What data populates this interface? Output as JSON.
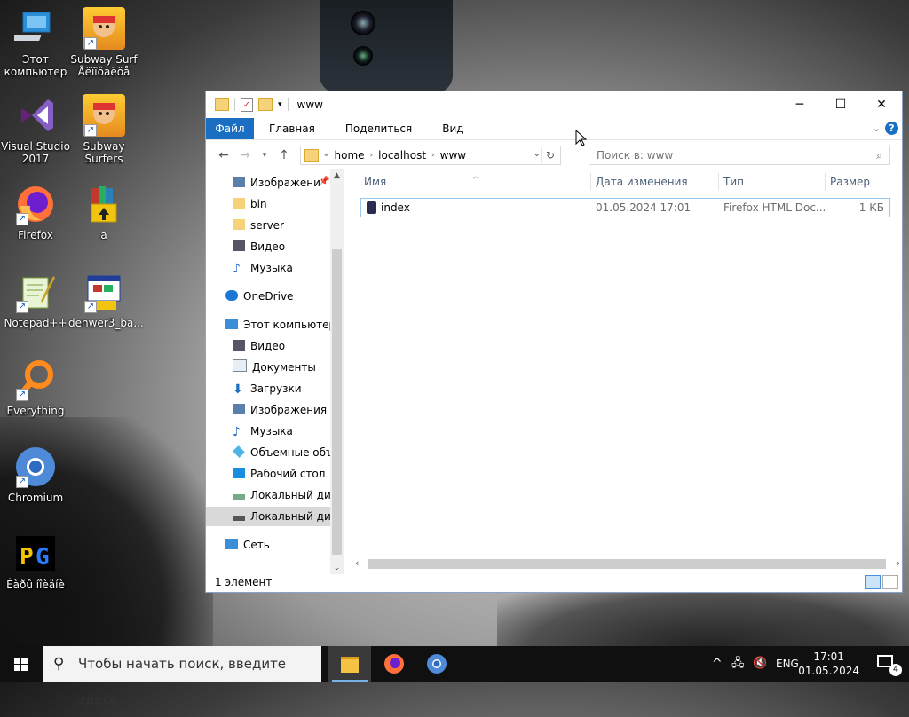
{
  "desktop": {
    "icons": [
      {
        "label": "Этот\nкомпьютер"
      },
      {
        "label": "Subway Surf\nÂëïîôàëöå"
      },
      {
        "label": "Visual Studio\n2017"
      },
      {
        "label": "Subway\nSurfers"
      },
      {
        "label": "Firefox"
      },
      {
        "label": "a"
      },
      {
        "label": "Notepad++"
      },
      {
        "label": "denwer3_ba..."
      },
      {
        "label": "Everything"
      },
      {
        "label": "Chromium"
      },
      {
        "label": "Êàðû íîèäíè"
      }
    ]
  },
  "explorer": {
    "title": "www",
    "ribbon": {
      "file": "Файл",
      "tabs": [
        "Главная",
        "Поделиться",
        "Вид"
      ]
    },
    "breadcrumbs": [
      "home",
      "localhost",
      "www"
    ],
    "search_placeholder": "Поиск в: www",
    "nav_items": [
      {
        "label": "Изображени",
        "pinned": true
      },
      {
        "label": "bin"
      },
      {
        "label": "server"
      },
      {
        "label": "Видео"
      },
      {
        "label": "Музыка"
      },
      {
        "label": "OneDrive"
      },
      {
        "label": "Этот компьютер"
      },
      {
        "label": "Видео"
      },
      {
        "label": "Документы"
      },
      {
        "label": "Загрузки"
      },
      {
        "label": "Изображения"
      },
      {
        "label": "Музыка"
      },
      {
        "label": "Объемные объ"
      },
      {
        "label": "Рабочий стол"
      },
      {
        "label": "Локальный дис"
      },
      {
        "label": "Локальный дис"
      },
      {
        "label": "Сеть"
      }
    ],
    "columns": [
      "Имя",
      "Дата изменения",
      "Тип",
      "Размер"
    ],
    "files": [
      {
        "name": "index",
        "date": "01.05.2024 17:01",
        "type": "Firefox HTML Doc...",
        "size": "1 КБ"
      }
    ],
    "status": "1 элемент"
  },
  "taskbar": {
    "search_placeholder": "Чтобы начать поиск, введите здесь",
    "lang": "ENG",
    "time": "17:01",
    "date": "01.05.2024",
    "notifications": "4"
  },
  "colors": {
    "accent": "#1a6fc2",
    "selection": "#cce8ff",
    "taskbar": "#101010"
  }
}
